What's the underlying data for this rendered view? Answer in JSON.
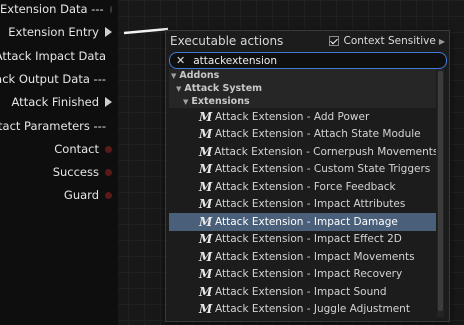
{
  "graph_node": {
    "pins": [
      {
        "label": "Extension Data ---",
        "kind": "data",
        "color": "#3a3a3a"
      },
      {
        "label": "Extension Entry",
        "kind": "exec",
        "color": "#d0d0d0"
      },
      {
        "label": "Attack Impact Data",
        "kind": "data",
        "color": "#1f3f6f"
      },
      {
        "label": "ack Output Data ---",
        "kind": "data",
        "color": "#3a3a3a"
      },
      {
        "label": "Attack Finished",
        "kind": "exec",
        "color": "#d0d0d0"
      },
      {
        "label": "tact Parameters ---",
        "kind": "data",
        "color": "#3a3a3a"
      },
      {
        "label": "Contact",
        "kind": "data",
        "color": "#5a1a1a"
      },
      {
        "label": "Success",
        "kind": "data",
        "color": "#5a1a1a"
      },
      {
        "label": "Guard",
        "kind": "data",
        "color": "#5a1a1a"
      }
    ]
  },
  "menu": {
    "title": "Executable actions",
    "context_sensitive_label": "Context Sensitive",
    "context_sensitive_checked": true,
    "search_value": "attackextension",
    "categories": {
      "addons": "Addons",
      "attack_system": "Attack System",
      "extensions": "Extensions"
    },
    "items": [
      "Attack Extension - Add Power",
      "Attack Extension - Attach State Module",
      "Attack Extension - Cornerpush Movements",
      "Attack Extension - Custom State Triggers",
      "Attack Extension - Force Feedback",
      "Attack Extension - Impact Attributes",
      "Attack Extension - Impact Damage",
      "Attack Extension - Impact Effect 2D",
      "Attack Extension - Impact Movements",
      "Attack Extension - Impact Recovery",
      "Attack Extension - Impact Sound",
      "Attack Extension - Juggle Adjustment"
    ],
    "selected_item": "Attack Extension - Impact Damage",
    "item_icon_glyph": "M",
    "item_icon_name": "function-icon"
  },
  "colors": {
    "selection": "#4a5f7a",
    "search_border": "#3d7bd6"
  }
}
